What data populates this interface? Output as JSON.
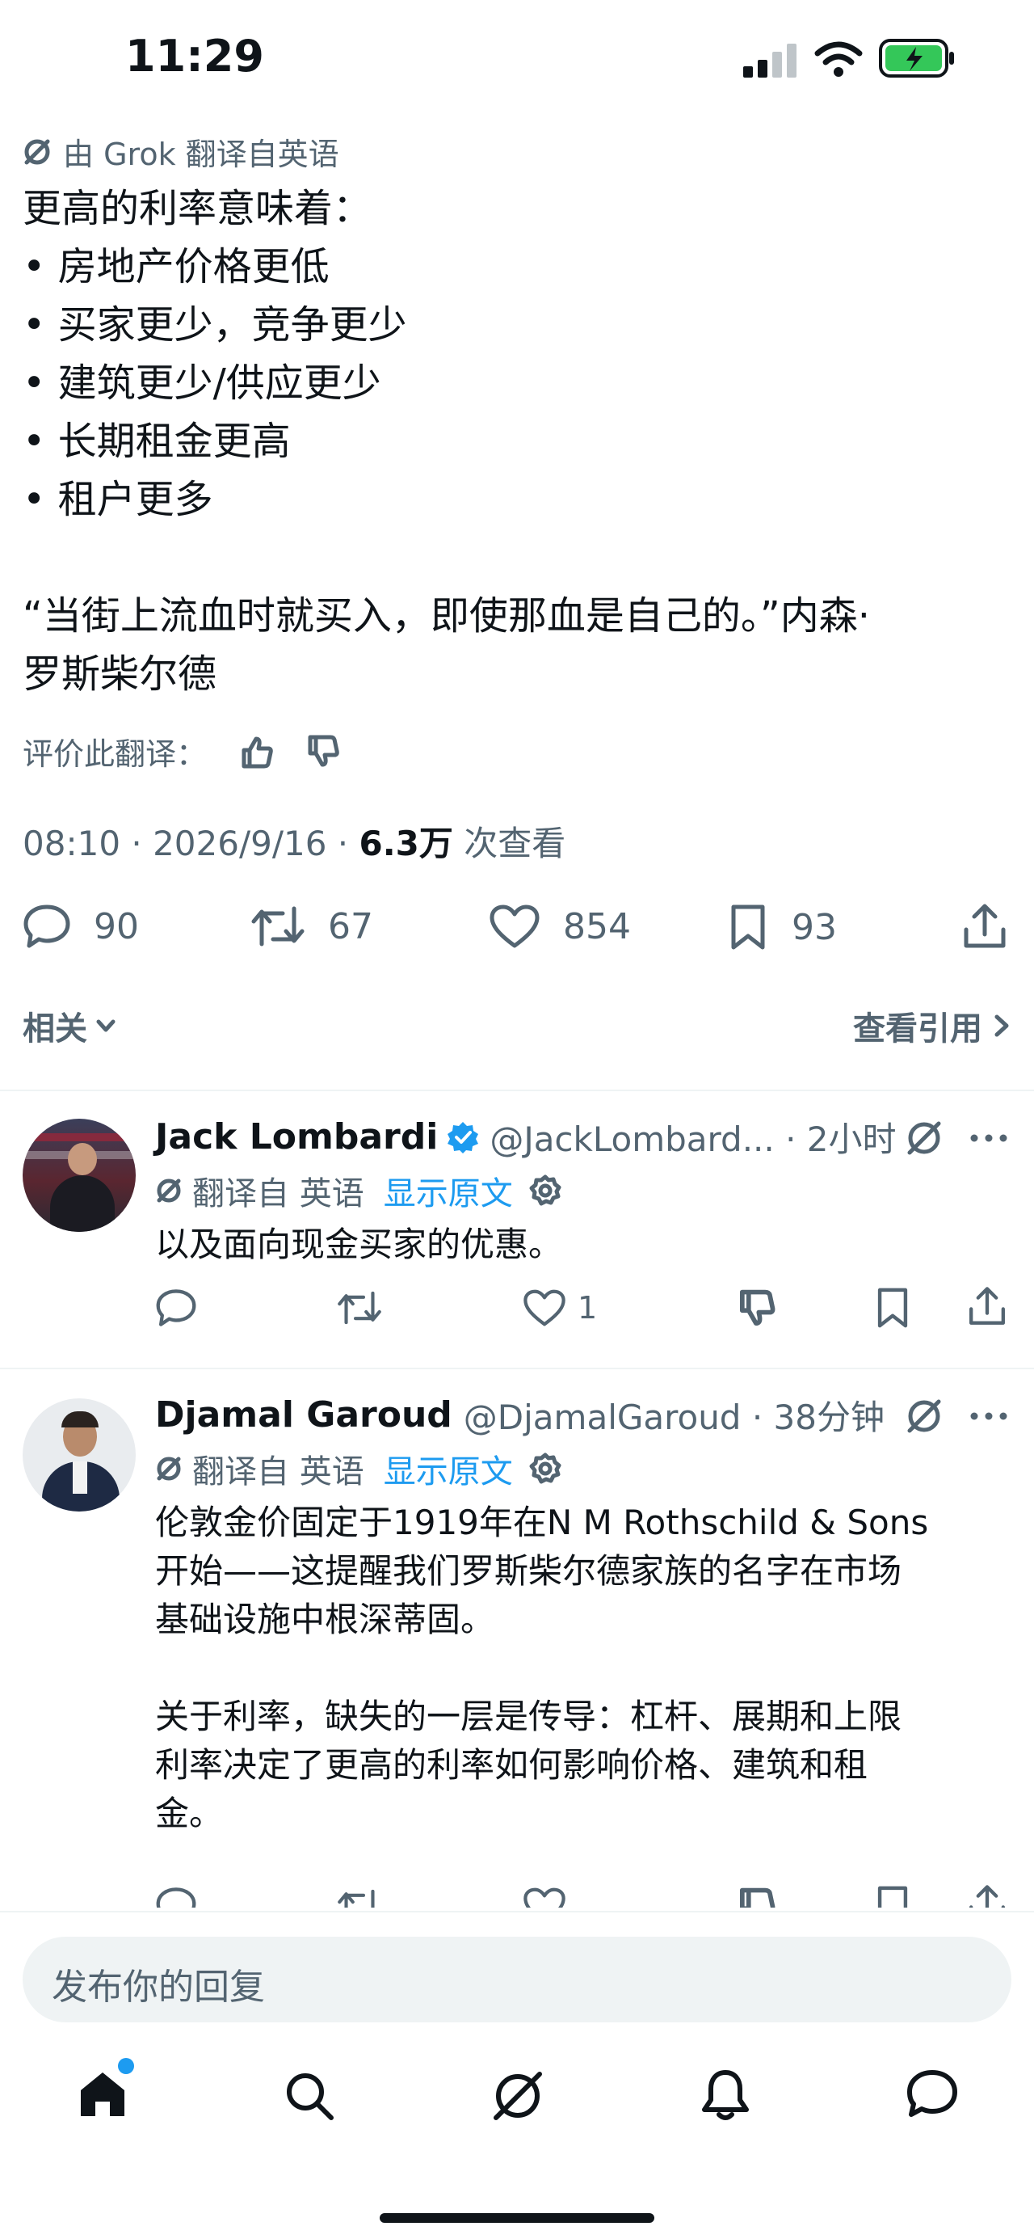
{
  "status_bar": {
    "time": "11:29"
  },
  "post": {
    "translation_note": "由 Grok 翻译自英语",
    "lines": [
      "更高的利率意味着：",
      "• 房地产价格更低",
      "• 买家更少，竞争更少",
      "• 建筑更少/供应更少",
      "• 长期租金更高",
      "• 租户更多",
      "“当街上流血时就买入，即使那血是自己的。”内森·",
      "罗斯柴尔德"
    ],
    "rate_label": "评价此翻译：",
    "meta": {
      "time_date": "08:10 · 2026/9/16 · ",
      "views": "6.3万",
      "views_suffix": " 次查看"
    },
    "actions": {
      "replies": "90",
      "reposts": "67",
      "likes": "854",
      "bookmarks": "93"
    }
  },
  "related": {
    "label": "相关",
    "quotes_label": "查看引用"
  },
  "replies": [
    {
      "name": "Jack Lombardi",
      "handle_time": "@JackLombard... · 2小时",
      "translated_from": "翻译自 英语",
      "show_original": "显示原文",
      "text": [
        "以及面向现金买家的优惠。"
      ],
      "likes": "1"
    },
    {
      "name": "Djamal Garoud",
      "handle_time": "@DjamalGaroud · 38分钟",
      "translated_from": "翻译自 英语",
      "show_original": "显示原文",
      "text": [
        "伦敦金价固定于1919年在N M Rothschild & Sons",
        "开始——这提醒我们罗斯柴尔德家族的名字在市场",
        "基础设施中根深蒂固。",
        "",
        "关于利率，缺失的一层是传导：杠杆、展期和上限",
        "利率决定了更高的利率如何影响价格、建筑和租",
        "金。"
      ]
    }
  ],
  "composer": {
    "placeholder": "发布你的回复"
  },
  "colors": {
    "accent": "#1d9bf0",
    "battery": "#34c759",
    "muted": "#536471",
    "text": "#0f1419"
  }
}
